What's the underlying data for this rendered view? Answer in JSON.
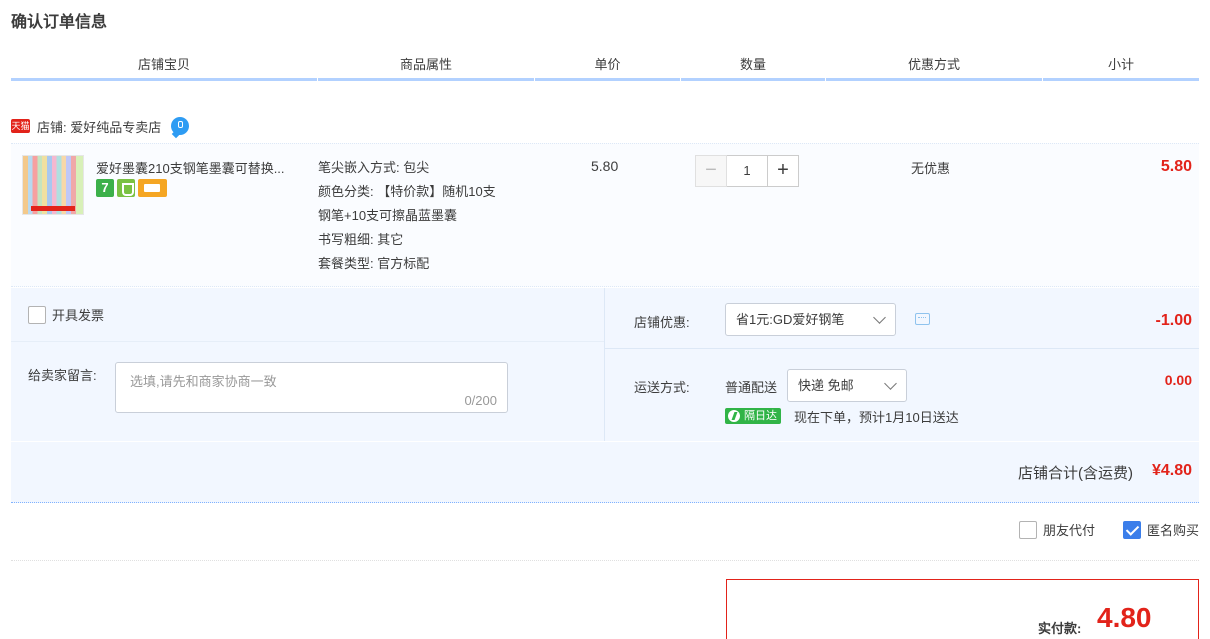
{
  "page_title": "确认订单信息",
  "columns": [
    "店铺宝贝",
    "商品属性",
    "单价",
    "数量",
    "优惠方式",
    "小计"
  ],
  "shop": {
    "badge": "天猫",
    "label": "店铺: 爱好纯品专卖店"
  },
  "item": {
    "title": "爱好墨囊210支钢笔墨囊可替换...",
    "service_icons": [
      "seven-day-return-icon",
      "guarantee-shield-icon",
      "credit-card-icon"
    ],
    "attrs": [
      "笔尖嵌入方式: 包尖",
      "颜色分类: 【特价款】随机10支",
      "钢笔+10支可擦晶蓝墨囊",
      "书写粗细: 其它",
      "套餐类型: 官方标配"
    ],
    "unit_price": "5.80",
    "quantity": "1",
    "qty_minus": "−",
    "qty_plus": "+",
    "promo": "无优惠",
    "subtotal": "5.80"
  },
  "invoice_label": "开具发票",
  "message": {
    "label": "给卖家留言:",
    "placeholder": "选填,请先和商家协商一致",
    "counter": "0/200"
  },
  "shop_promo": {
    "label": "店铺优惠:",
    "selected": "省1元:GD爱好钢笔",
    "amount": "-1.00"
  },
  "shipping": {
    "label": "运送方式:",
    "type": "普通配送",
    "selected": "快递 免邮",
    "fee": "0.00",
    "badge": "隔日达",
    "eta": "现在下单，预计1月10日送达"
  },
  "shop_total": {
    "label": "店铺合计(含运费)",
    "value": "¥4.80"
  },
  "options": {
    "friend_pay": "朋友代付",
    "anonymous": "匿名购买"
  },
  "payment": {
    "label": "实付款:",
    "amount": "4.80"
  },
  "colors": {
    "accent_red": "#e2231a",
    "header_line_blue": "#b2d1ff",
    "section_bg": "#f2f7ff",
    "checkbox_blue": "#3b7eea"
  }
}
